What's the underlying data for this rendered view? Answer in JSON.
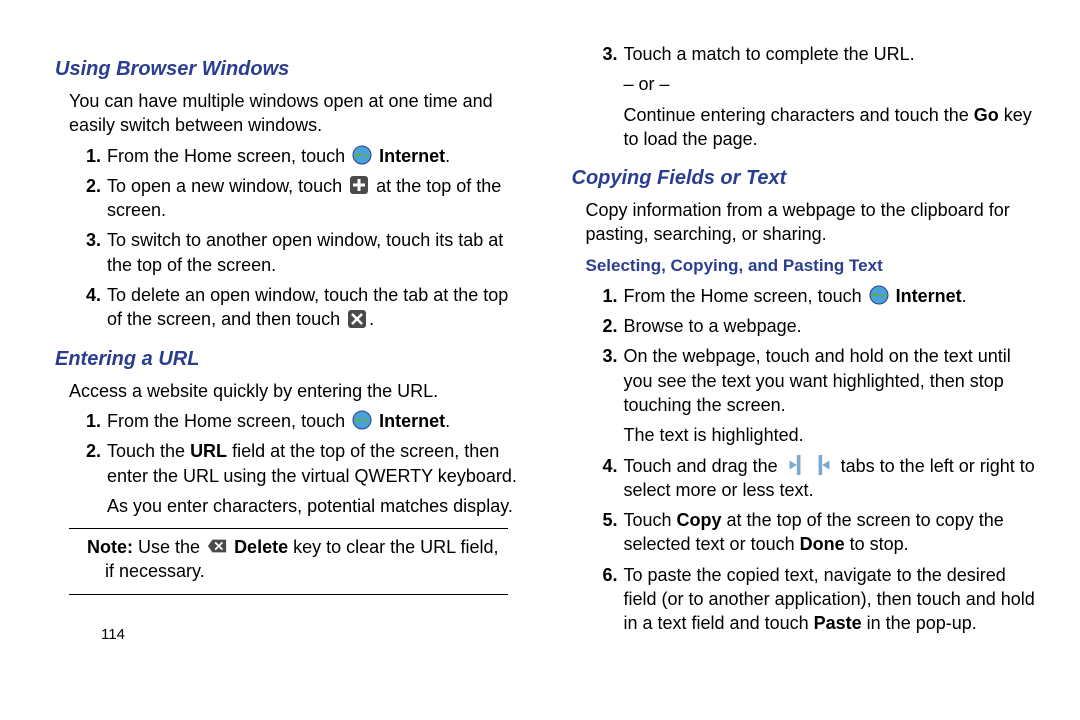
{
  "page_number": "114",
  "left": {
    "h1": "Using Browser Windows",
    "p1": "You can have multiple windows open at one time and easily switch between windows.",
    "l1": [
      {
        "num": "1.",
        "pre": "From the Home screen, touch ",
        "post_bold": "Internet",
        "tail": "."
      },
      {
        "num": "2.",
        "pre": "To open a new window, touch ",
        "tail2": " at the top of the screen."
      },
      {
        "num": "3.",
        "full": "To switch to another open window, touch its tab at the top of the screen."
      },
      {
        "num": "4.",
        "pre": "To delete an open window, touch the tab at the top of the screen, and then touch ",
        "tail": "."
      }
    ],
    "h2": "Entering a URL",
    "p2": "Access a website quickly by entering the URL.",
    "l2": [
      {
        "num": "1.",
        "pre": "From the Home screen, touch ",
        "post_bold": "Internet",
        "tail": "."
      },
      {
        "num": "2.",
        "pre": "Touch the ",
        "bold": "URL",
        "mid": " field at the top of the screen, then enter the URL using the virtual QWERTY keyboard.",
        "sub": "As you enter characters, potential matches display."
      }
    ],
    "note_label": "Note:",
    "note_pre": " Use the ",
    "note_bold": "Delete",
    "note_post": " key to clear the URL field, if necessary."
  },
  "right": {
    "l1": [
      {
        "num": "3.",
        "line1": "Touch a match to complete the URL.",
        "or": "– or –",
        "line2a": "Continue entering characters and touch the ",
        "line2bold": "Go",
        "line2b": " key to load the page."
      }
    ],
    "h1": "Copying Fields or Text",
    "p1": "Copy information from a webpage to the clipboard for pasting, searching, or sharing.",
    "sub1": "Selecting, Copying, and Pasting Text",
    "l2": [
      {
        "num": "1.",
        "pre": "From the Home screen, touch ",
        "post_bold": "Internet",
        "tail": "."
      },
      {
        "num": "2.",
        "full": "Browse to a webpage."
      },
      {
        "num": "3.",
        "full": "On the webpage, touch and hold on the text until you see the text you want highlighted, then stop touching the screen.",
        "sub": "The text is highlighted."
      },
      {
        "num": "4.",
        "pre": "Touch and drag the ",
        "mid": " tabs to the left or right to select more or less text."
      },
      {
        "num": "5.",
        "pre": "Touch ",
        "bold1": "Copy",
        "mid": " at the top of the screen to copy the selected text or touch ",
        "bold2": "Done",
        "tail": " to stop."
      },
      {
        "num": "6.",
        "pre": "To paste the copied text, navigate to the desired field (or to another application), then touch and hold in a text field and touch ",
        "bold1": "Paste",
        "tail": " in the pop-up."
      }
    ]
  }
}
